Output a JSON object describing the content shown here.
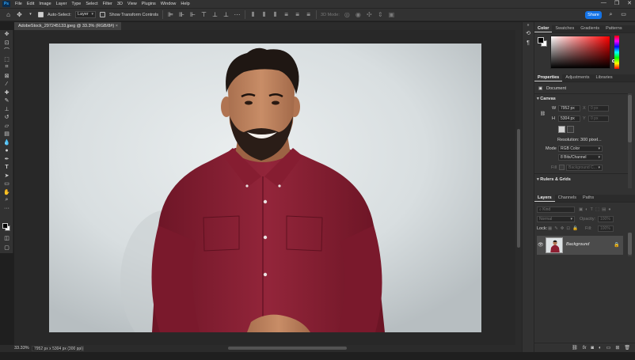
{
  "menubar": {
    "logo": "Ps",
    "items": [
      "File",
      "Edit",
      "Image",
      "Layer",
      "Type",
      "Select",
      "Filter",
      "3D",
      "View",
      "Plugins",
      "Window",
      "Help"
    ],
    "window_buttons": [
      "—",
      "❐",
      "✕"
    ]
  },
  "options_bar": {
    "auto_select_label": "Auto-Select:",
    "auto_select_checked": true,
    "auto_select_target": "Layer",
    "show_transform_label": "Show Transform Controls",
    "mode_3d_label": "3D Mode:",
    "share_label": "Share"
  },
  "document": {
    "tab_title": "AdobeStock_297245133.jpeg @ 33.3% (RGB/8#)",
    "close_glyph": "×",
    "zoom": "33.33%",
    "status_info": "7952 px x 5304 px (300 ppi)"
  },
  "color_panel": {
    "tabs": [
      "Color",
      "Swatches",
      "Gradients",
      "Patterns"
    ],
    "active_tab": "Color"
  },
  "properties_panel": {
    "tabs": [
      "Properties",
      "Adjustments",
      "Libraries"
    ],
    "active_tab": "Properties",
    "document_label": "Document",
    "canvas_section": "Canvas",
    "w_label": "W",
    "w_value": "7952 px",
    "h_label": "H",
    "h_value": "5304 px",
    "x_label": "X",
    "x_value": "0 px",
    "y_label": "Y",
    "y_value": "0 px",
    "resolution": "Resolution: 300 pixel...",
    "mode_label": "Mode",
    "mode_value": "RGB Color",
    "bits_value": "8 Bits/Channel",
    "fill_label": "Fill",
    "fill_value": "Background C...",
    "rulers_section": "Rulers & Grids"
  },
  "layers_panel": {
    "tabs": [
      "Layers",
      "Channels",
      "Paths"
    ],
    "active_tab": "Layers",
    "kind_label": "Kind",
    "blend_mode": "Normal",
    "opacity_label": "Opacity:",
    "opacity_value": "100%",
    "lock_label": "Lock:",
    "fill_label": "Fill:",
    "fill_value": "100%",
    "layer_name": "Background"
  },
  "colors": {
    "accent": "#1473e6",
    "shirt": "#8e1f32",
    "backdrop": "#dde2e4"
  }
}
